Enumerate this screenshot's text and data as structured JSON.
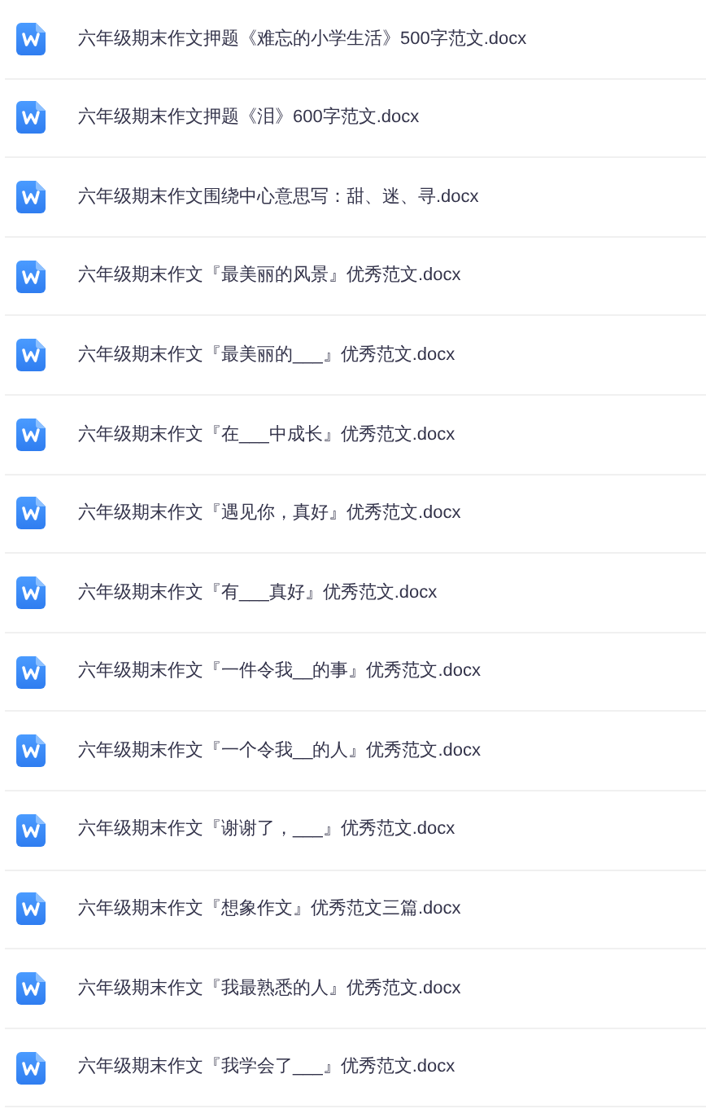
{
  "files": [
    {
      "name": "六年级期末作文押题《难忘的小学生活》500字范文.docx"
    },
    {
      "name": "六年级期末作文押题《泪》600字范文.docx"
    },
    {
      "name": "六年级期末作文围绕中心意思写：甜、迷、寻.docx"
    },
    {
      "name": "六年级期末作文『最美丽的风景』优秀范文.docx"
    },
    {
      "name": "六年级期末作文『最美丽的___』优秀范文.docx"
    },
    {
      "name": "六年级期末作文『在___中成长』优秀范文.docx"
    },
    {
      "name": "六年级期末作文『遇见你，真好』优秀范文.docx"
    },
    {
      "name": "六年级期末作文『有___真好』优秀范文.docx"
    },
    {
      "name": "六年级期末作文『一件令我__的事』优秀范文.docx"
    },
    {
      "name": "六年级期末作文『一个令我__的人』优秀范文.docx"
    },
    {
      "name": "六年级期末作文『谢谢了，___』优秀范文.docx"
    },
    {
      "name": "六年级期末作文『想象作文』优秀范文三篇.docx"
    },
    {
      "name": "六年级期末作文『我最熟悉的人』优秀范文.docx"
    },
    {
      "name": "六年级期末作文『我学会了___』优秀范文.docx"
    }
  ]
}
